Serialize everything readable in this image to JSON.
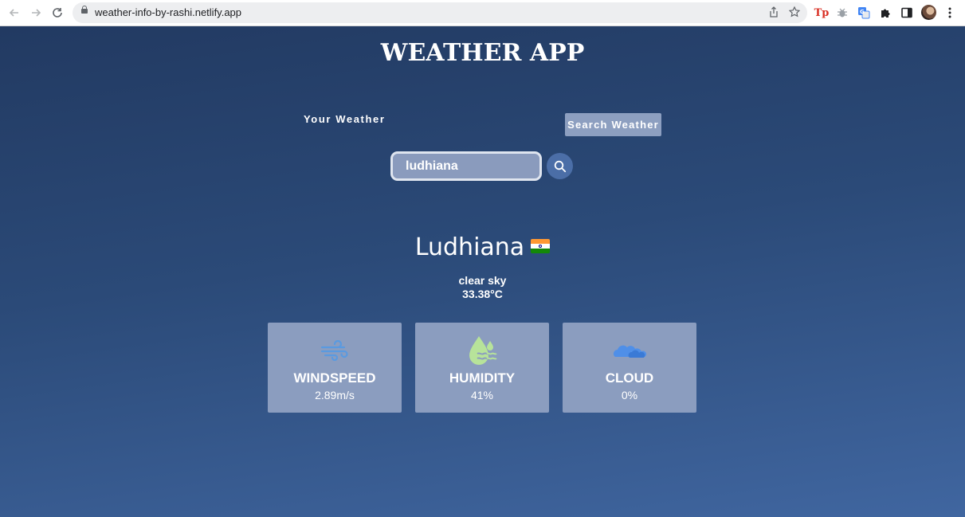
{
  "browser": {
    "url": "weather-info-by-rashi.netlify.app",
    "back_icon": "back-arrow-icon",
    "forward_icon": "forward-arrow-icon",
    "reload_icon": "reload-icon",
    "extension_tp_label": "Tp"
  },
  "app": {
    "title": "WEATHER APP",
    "tabs": {
      "your_weather": "Your Weather",
      "search_weather": "Search Weather"
    },
    "search": {
      "value": "ludhiana",
      "icon": "search-icon"
    },
    "location": {
      "city": "Ludhiana",
      "flag": "india-flag-icon",
      "description": "clear sky",
      "temperature": "33.38°C"
    },
    "stats": [
      {
        "label": "WINDSPEED",
        "value": "2.89m/s",
        "icon": "wind-icon"
      },
      {
        "label": "HUMIDITY",
        "value": "41%",
        "icon": "humidity-icon"
      },
      {
        "label": "CLOUD",
        "value": "0%",
        "icon": "cloud-icon"
      }
    ],
    "colors": {
      "background_top": "#223a62",
      "background_bottom": "#4066a0",
      "card": "#8b9dbf",
      "search_button": "#4b6ea7"
    }
  }
}
